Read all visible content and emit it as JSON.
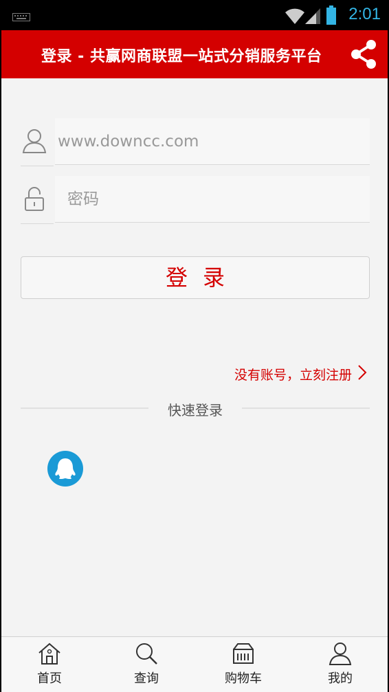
{
  "status_bar": {
    "time": "2:01",
    "icons": [
      "keyboard-icon",
      "wifi-icon",
      "signal-icon",
      "battery-icon"
    ]
  },
  "header": {
    "title": "登录 - 共赢网商联盟一站式分销服务平台",
    "share_icon": "share-icon"
  },
  "form": {
    "username_placeholder": "www.downcc.com",
    "password_placeholder": "密码",
    "login_label": "登录"
  },
  "register_link": "没有账号，立刻注册",
  "quick_login": {
    "label": "快速登录",
    "providers": [
      "qq-icon"
    ]
  },
  "bottom_nav": {
    "items": [
      {
        "label": "首页",
        "icon": "home-icon"
      },
      {
        "label": "查询",
        "icon": "search-icon"
      },
      {
        "label": "购物车",
        "icon": "cart-icon"
      },
      {
        "label": "我的",
        "icon": "user-icon"
      }
    ]
  },
  "colors": {
    "brand_red": "#d40000",
    "status_blue": "#33b5e5",
    "qq_blue": "#1a9ad6",
    "background": "#f3f3f3"
  }
}
